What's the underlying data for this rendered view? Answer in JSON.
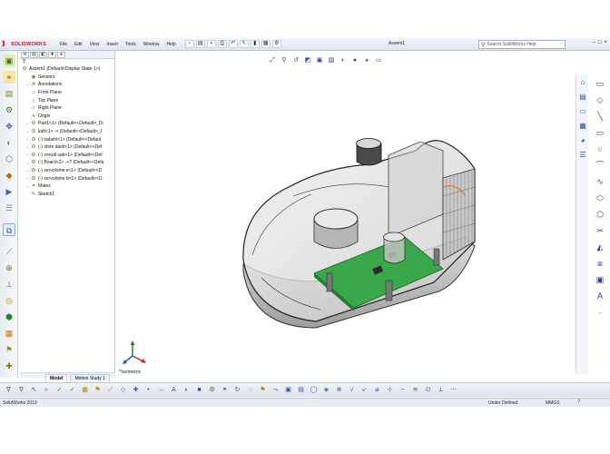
{
  "app": {
    "brand": "SOLIDWORKS",
    "document_title": "Assem1",
    "status_app": "SolidWorks 2013",
    "status_state": "Under Defined",
    "units": "MMGS",
    "help_glyph": "?"
  },
  "menu": [
    "File",
    "Edit",
    "View",
    "Insert",
    "Tools",
    "Window",
    "Help"
  ],
  "search": {
    "placeholder": "Search SolidWorks Help"
  },
  "window_controls": [
    "–",
    "□",
    "×"
  ],
  "feature_tree": {
    "filter_glyph": "∇",
    "root": "Assem1  (Default<Display State-1>)",
    "items": [
      {
        "label": "Sensors",
        "icon": "sensor-icon",
        "level": 1,
        "expander": ""
      },
      {
        "label": "Annotations",
        "icon": "annotation-icon",
        "level": 1,
        "expander": "+"
      },
      {
        "label": "Front Plane",
        "icon": "plane-icon",
        "level": 1,
        "expander": ""
      },
      {
        "label": "Top Plane",
        "icon": "plane-icon",
        "level": 1,
        "expander": ""
      },
      {
        "label": "Right Plane",
        "icon": "plane-icon",
        "level": 1,
        "expander": ""
      },
      {
        "label": "Origin",
        "icon": "origin-icon",
        "level": 1,
        "expander": ""
      },
      {
        "label": "Part1<1> (Default<<Default>_Di",
        "icon": "part-icon",
        "level": 1,
        "expander": "+"
      },
      {
        "label": "kafi<1> -> (Default<<Default>_I",
        "icon": "part-icon",
        "level": 1,
        "expander": "+"
      },
      {
        "label": "(-) nabshi<1> (Default<<Defaul",
        "icon": "part-icon",
        "level": 1,
        "expander": "+"
      },
      {
        "label": "(-) shire dasti<1> (Default<<Def",
        "icon": "part-icon",
        "level": 1,
        "expander": "+"
      },
      {
        "label": "(-) vorudi sab<1> (Default<<Def",
        "icon": "part-icon",
        "level": 1,
        "expander": "+"
      },
      {
        "label": "(-) Board<2> ->? (Default<<Defa",
        "icon": "part-icon",
        "level": 1,
        "expander": "+"
      },
      {
        "label": "(-) servolome s<1> (Default<<D",
        "icon": "part-icon",
        "level": 1,
        "expander": "+"
      },
      {
        "label": "(-) servolome b<1> (Default<<D",
        "icon": "part-icon",
        "level": 1,
        "expander": "+"
      },
      {
        "label": "Mates",
        "icon": "mates-icon",
        "level": 1,
        "expander": "+"
      },
      {
        "label": "Sketch1",
        "icon": "sketch-icon",
        "level": 1,
        "expander": ""
      }
    ],
    "bottom_tabs": [
      "Model",
      "Motion Study 1"
    ]
  },
  "viewport": {
    "view_name": "*Isometric"
  },
  "colors": {
    "pcb": "#3aa84a",
    "accent": "#c8102e",
    "part_gray": "#a9a9a9"
  }
}
